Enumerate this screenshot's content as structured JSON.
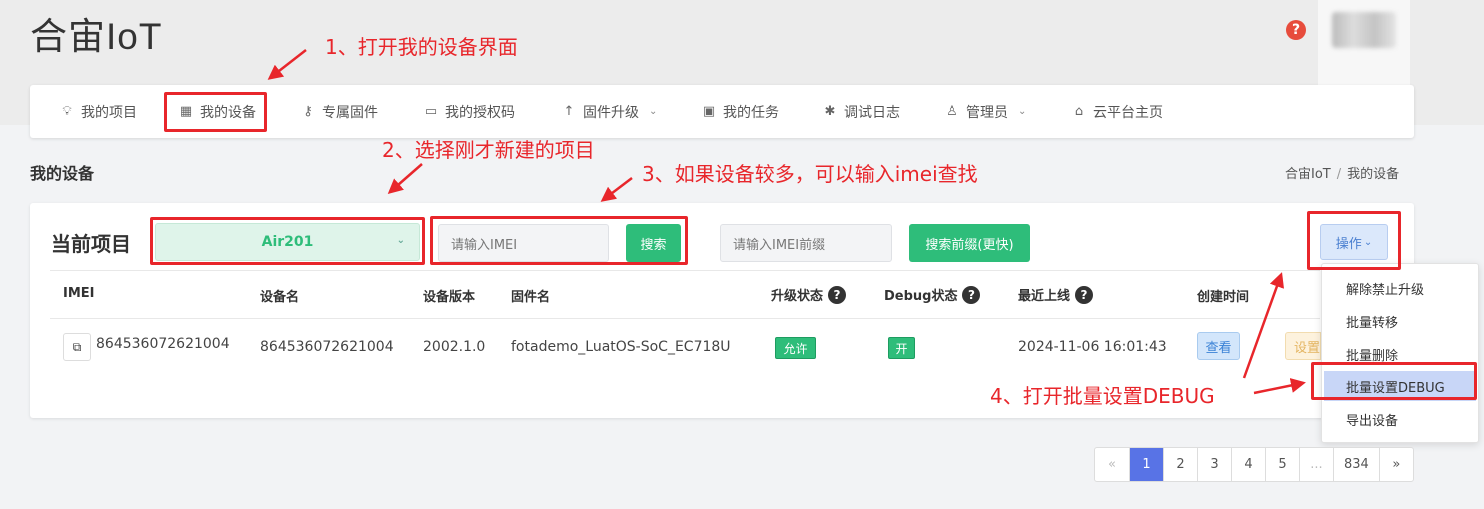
{
  "app": {
    "brand": "合宙IoT",
    "help_icon": "help-icon"
  },
  "nav": {
    "items": [
      {
        "label": "我的项目",
        "icon": "lightbulb-icon"
      },
      {
        "label": "我的设备",
        "icon": "chip-icon"
      },
      {
        "label": "专属固件",
        "icon": "key-icon"
      },
      {
        "label": "我的授权码",
        "icon": "card-icon"
      },
      {
        "label": "固件升级",
        "icon": "arrow-up-icon",
        "has_dropdown": true
      },
      {
        "label": "我的任务",
        "icon": "calendar-icon"
      },
      {
        "label": "调试日志",
        "icon": "bug-icon"
      },
      {
        "label": "管理员",
        "icon": "user-icon",
        "has_dropdown": true
      },
      {
        "label": "云平台主页",
        "icon": "home-icon"
      }
    ]
  },
  "page": {
    "title": "我的设备",
    "breadcrumb": [
      "合宙IoT",
      "我的设备"
    ],
    "breadcrumb_sep": "/"
  },
  "toolbar": {
    "project_label": "当前项目",
    "project_selected": "Air201",
    "imei_placeholder": "请输入IMEI",
    "search_label": "搜索",
    "prefix_placeholder": "请输入IMEI前缀",
    "prefix_search_label": "搜索前缀(更快)",
    "operate_label": "操作",
    "operate_caret": "⌄"
  },
  "table": {
    "headers": [
      "IMEI",
      "设备名",
      "设备版本",
      "固件名",
      "升级状态",
      "Debug状态",
      "最近上线",
      "创建时间"
    ],
    "rows": [
      {
        "imei": "864536072621004",
        "name": "864536072621004",
        "version": "2002.1.0",
        "firmware": "fotademo_LuatOS-SoC_EC718U",
        "upgrade_status": "允许",
        "debug_status": "开",
        "last_online": "2024-11-06 16:01:43",
        "view_label": "查看",
        "setting_label": "设置"
      }
    ]
  },
  "operate_menu": {
    "items": [
      "解除禁止升级",
      "批量转移",
      "批量删除",
      "批量设置DEBUG",
      "导出设备"
    ],
    "highlighted_index": 3
  },
  "pagination": {
    "prev": "«",
    "pages": [
      "1",
      "2",
      "3",
      "4",
      "5",
      "...",
      "834"
    ],
    "next": "»",
    "current": "1"
  },
  "annotations": {
    "step1": "1、打开我的设备界面",
    "step2": "2、选择刚才新建的项目",
    "step3": "3、如果设备较多，可以输入imei查找",
    "step4": "4、打开批量设置DEBUG",
    "color": "#e8262b"
  },
  "colors": {
    "accent_green": "#2ebd7a",
    "accent_blue": "#5873e6",
    "warning": "#e74c3c"
  }
}
